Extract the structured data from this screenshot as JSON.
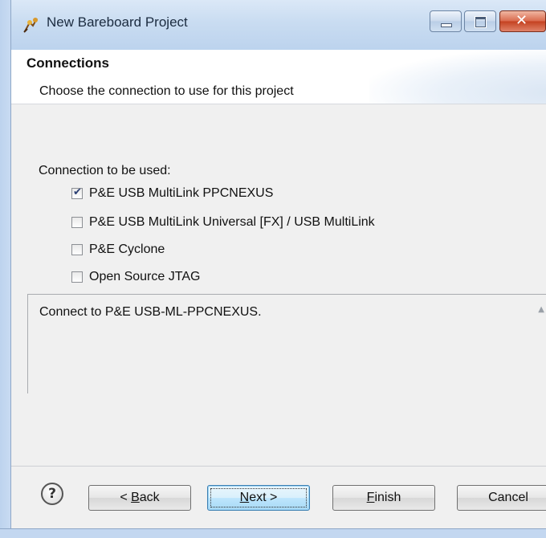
{
  "window": {
    "title": "New Bareboard Project",
    "controls": {
      "minimize": "minimize",
      "maximize": "maximize",
      "close": "close"
    }
  },
  "header": {
    "title": "Connections",
    "description": "Choose the connection to use for this project"
  },
  "connections": {
    "label": "Connection to be used:",
    "options": [
      {
        "label": "P&E USB MultiLink PPCNEXUS",
        "checked": true
      },
      {
        "label": "P&E USB MultiLink Universal [FX] / USB MultiLink",
        "checked": false
      },
      {
        "label": "P&E Cyclone",
        "checked": false
      },
      {
        "label": "Open Source JTAG",
        "checked": false
      }
    ],
    "description": "Connect to P&E USB-ML-PPCNEXUS."
  },
  "footer": {
    "help_icon": "help-icon",
    "back": {
      "mnemonic": "B",
      "rest": "ack",
      "prefix": "< "
    },
    "next": {
      "mnemonic": "N",
      "rest": "ext >"
    },
    "finish": {
      "mnemonic": "F",
      "rest": "inish"
    },
    "cancel": "Cancel"
  },
  "colors": {
    "title_bar": "#c9dcf1",
    "close_button": "#c4411f",
    "default_button": "#bee6fd",
    "dialog_bg": "#f0f0f0"
  }
}
